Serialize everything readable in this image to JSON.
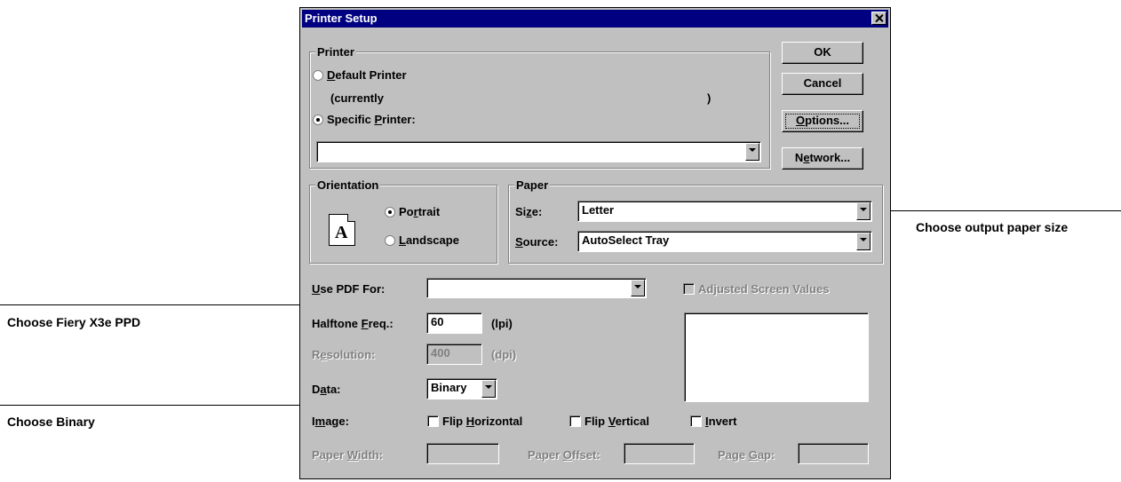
{
  "dialog": {
    "title": "Printer Setup"
  },
  "printer_group": {
    "legend": "Printer",
    "default_printer": {
      "pre": "",
      "key": "D",
      "post": "efault Printer",
      "selected": false
    },
    "currently_label": "(currently",
    "currently_close": ")",
    "specific_printer": {
      "pre": "Specific ",
      "key": "P",
      "post": "rinter:",
      "selected": true
    },
    "printer_select_value": ""
  },
  "buttons": {
    "ok": "OK",
    "cancel": "Cancel",
    "options": {
      "key": "O",
      "post": "ptions..."
    },
    "network": {
      "pre": "N",
      "key": "e",
      "post": "twork..."
    }
  },
  "orientation_group": {
    "legend": "Orientation",
    "icon_letter": "A",
    "portrait": {
      "pre": "Po",
      "key": "r",
      "post": "trait",
      "selected": true
    },
    "landscape": {
      "pre": "",
      "key": "L",
      "post": "andscape",
      "selected": false
    }
  },
  "paper_group": {
    "legend": "Paper",
    "size_label": {
      "pre": "Si",
      "key": "z",
      "post": "e:"
    },
    "size_value": "Letter",
    "source_label": {
      "pre": "",
      "key": "S",
      "post": "ource:"
    },
    "source_value": "AutoSelect Tray"
  },
  "options": {
    "use_pdf_label": {
      "pre": "",
      "key": "U",
      "post": "se PDF For:"
    },
    "use_pdf_value": "",
    "adjusted_screen": {
      "pre": "Ad",
      "key": "j",
      "post": "usted Screen Values"
    },
    "halftone_label": {
      "pre": "Halftone ",
      "key": "F",
      "post": "req.:"
    },
    "halftone_value": "60",
    "halftone_unit": "(lpi)",
    "resolution_label": {
      "pre": "R",
      "key": "e",
      "post": "solution:"
    },
    "resolution_value": "400",
    "resolution_unit": "(dpi)",
    "data_label": {
      "pre": "D",
      "key": "a",
      "post": "ta:"
    },
    "data_value": "Binary",
    "image_label": {
      "pre": "I",
      "key": "m",
      "post": "age:"
    },
    "flip_horizontal": {
      "pre": "Flip ",
      "key": "H",
      "post": "orizontal"
    },
    "flip_vertical": {
      "pre": "Flip ",
      "key": "V",
      "post": "ertical"
    },
    "invert": {
      "pre": "",
      "key": "I",
      "post": "nvert"
    },
    "paper_width": {
      "pre": "Paper ",
      "key": "W",
      "post": "idth:"
    },
    "paper_offset": {
      "pre": "Paper ",
      "key": "O",
      "post": "ffset:"
    },
    "page_gap": {
      "pre": "Page ",
      "key": "G",
      "post": "ap:"
    }
  },
  "callouts": {
    "paper_size": "Choose output paper size",
    "ppd": "Choose Fiery X3e PPD",
    "binary": "Choose Binary"
  },
  "colors": {
    "titlebar": "#000080",
    "face": "#c0c0c0",
    "disabled_text": "#808080"
  }
}
